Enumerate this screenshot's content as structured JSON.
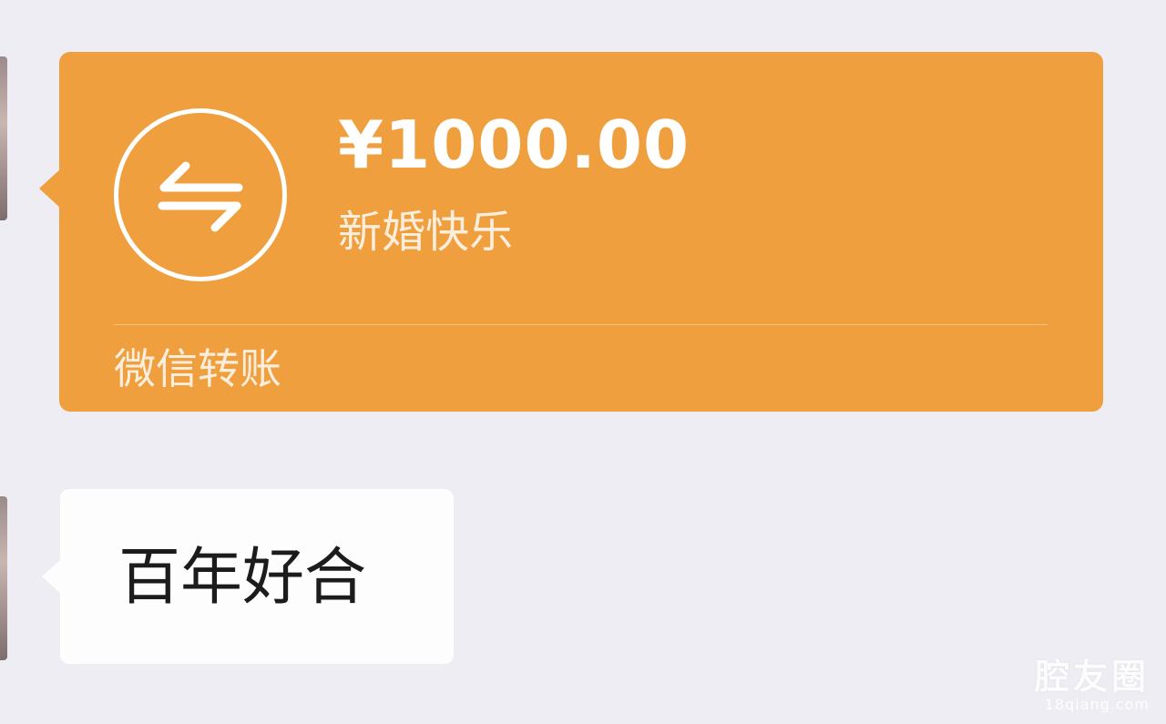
{
  "transfer": {
    "amount": "¥1000.00",
    "memo": "新婚快乐",
    "footer_label": "微信转账",
    "icon": "transfer-arrows-icon",
    "accent_color": "#ef9f3e"
  },
  "message": {
    "text": "百年好合"
  },
  "watermark": {
    "title": "腔友圈",
    "url": "18qiang.com"
  }
}
